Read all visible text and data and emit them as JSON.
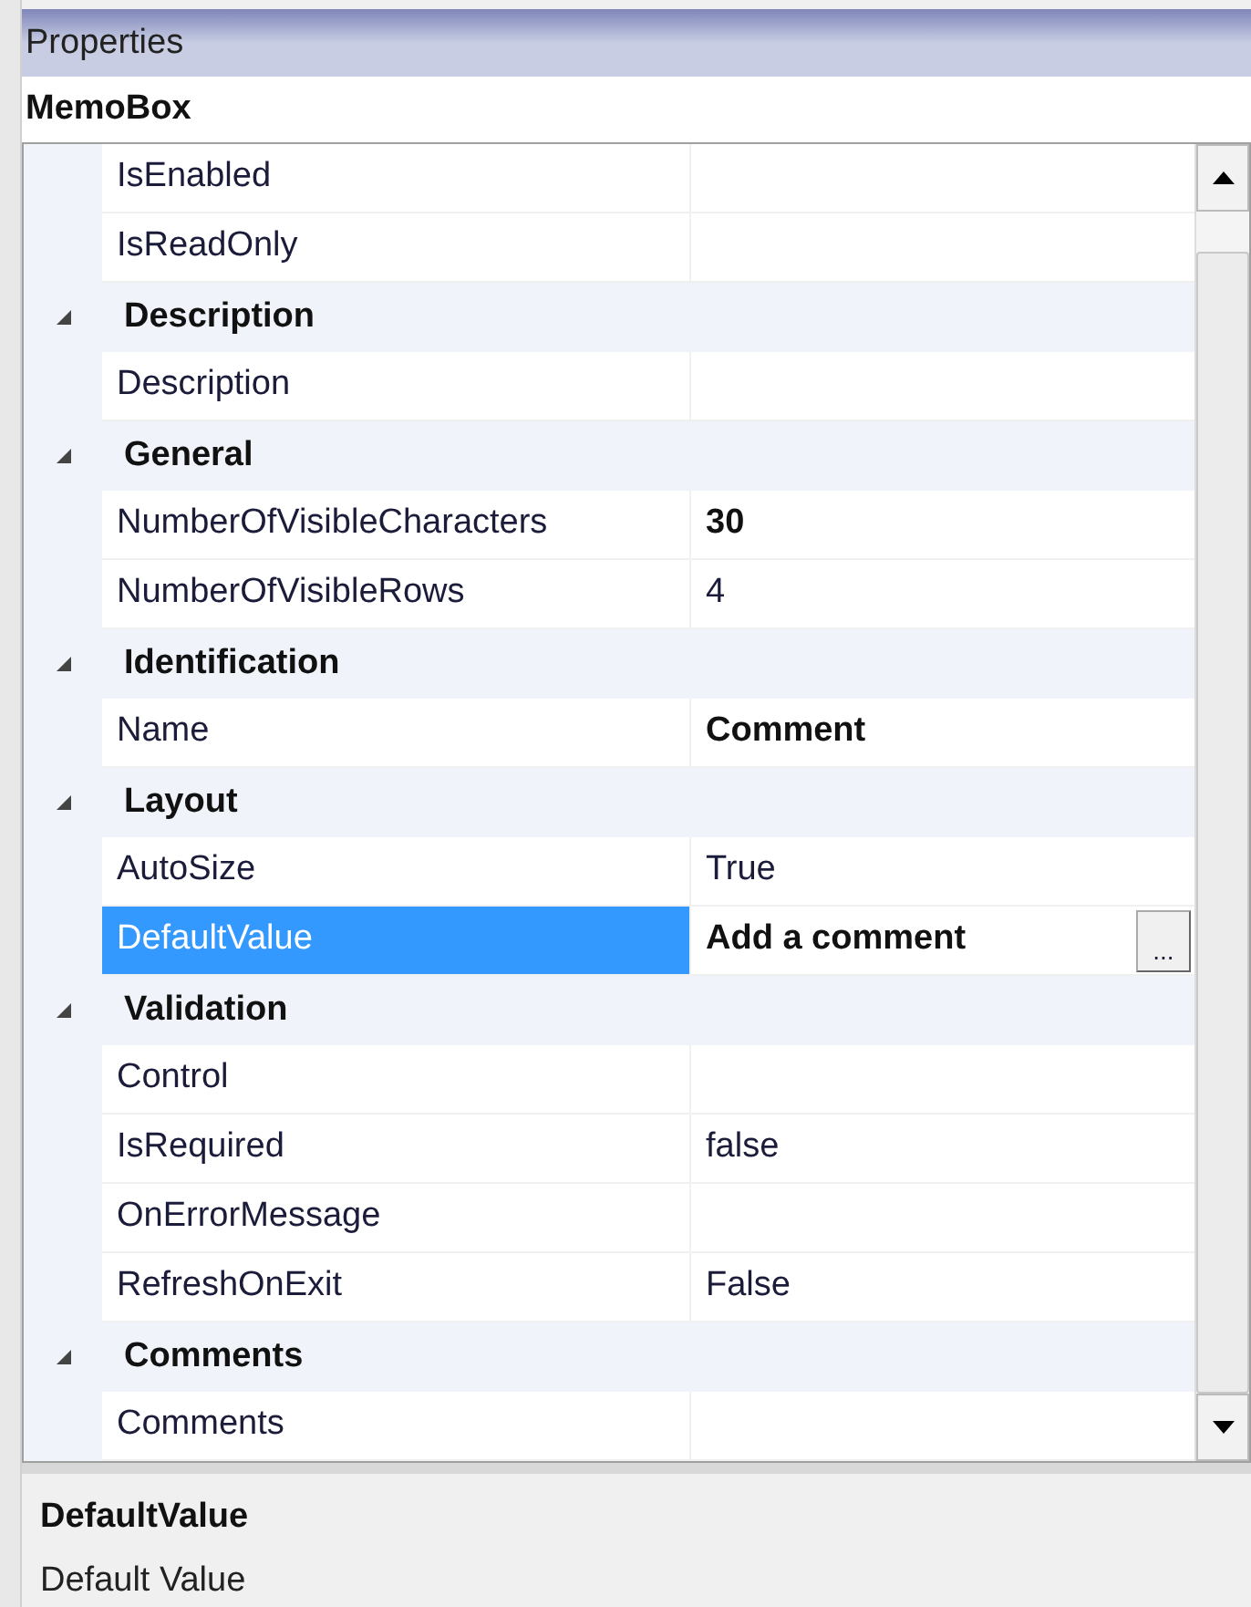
{
  "window": {
    "title": "Properties"
  },
  "object_name": "MemoBox",
  "rows": [
    {
      "kind": "property",
      "name": "IsEnabled",
      "selected": false
    },
    {
      "kind": "property",
      "name": "IsReadOnly",
      "selected": false
    },
    {
      "kind": "category",
      "name": "Description",
      "expanded": true
    },
    {
      "kind": "property",
      "name": "Description",
      "selected": false
    },
    {
      "kind": "category",
      "name": "General",
      "expanded": true
    },
    {
      "kind": "property",
      "name": "NumberOfVisibleCharacters",
      "value": "30",
      "modified": true,
      "selected": false
    },
    {
      "kind": "property",
      "name": "NumberOfVisibleRows",
      "value": "4",
      "modified": false,
      "selected": false
    },
    {
      "kind": "category",
      "name": "Identification",
      "expanded": true
    },
    {
      "kind": "property",
      "name": "Name",
      "value": "Comment",
      "modified": true,
      "selected": false
    },
    {
      "kind": "category",
      "name": "Layout",
      "expanded": true
    },
    {
      "kind": "property",
      "name": "AutoSize",
      "value": "True",
      "modified": false,
      "selected": false
    },
    {
      "kind": "property",
      "name": "DefaultValue",
      "value": "Add a comment",
      "modified": true,
      "selected": true,
      "ellipsis_button": "..."
    },
    {
      "kind": "category",
      "name": "Validation",
      "expanded": true
    },
    {
      "kind": "property",
      "name": "Control",
      "selected": false
    },
    {
      "kind": "property",
      "name": "IsRequired",
      "value": "false",
      "modified": false,
      "selected": false
    },
    {
      "kind": "property",
      "name": "OnErrorMessage",
      "selected": false
    },
    {
      "kind": "property",
      "name": "RefreshOnExit",
      "value": "False",
      "modified": false,
      "selected": false
    },
    {
      "kind": "category",
      "name": "Comments",
      "expanded": true
    },
    {
      "kind": "property",
      "name": "Comments",
      "selected": false
    }
  ],
  "description": {
    "title": "DefaultValue",
    "text": "Default Value"
  }
}
